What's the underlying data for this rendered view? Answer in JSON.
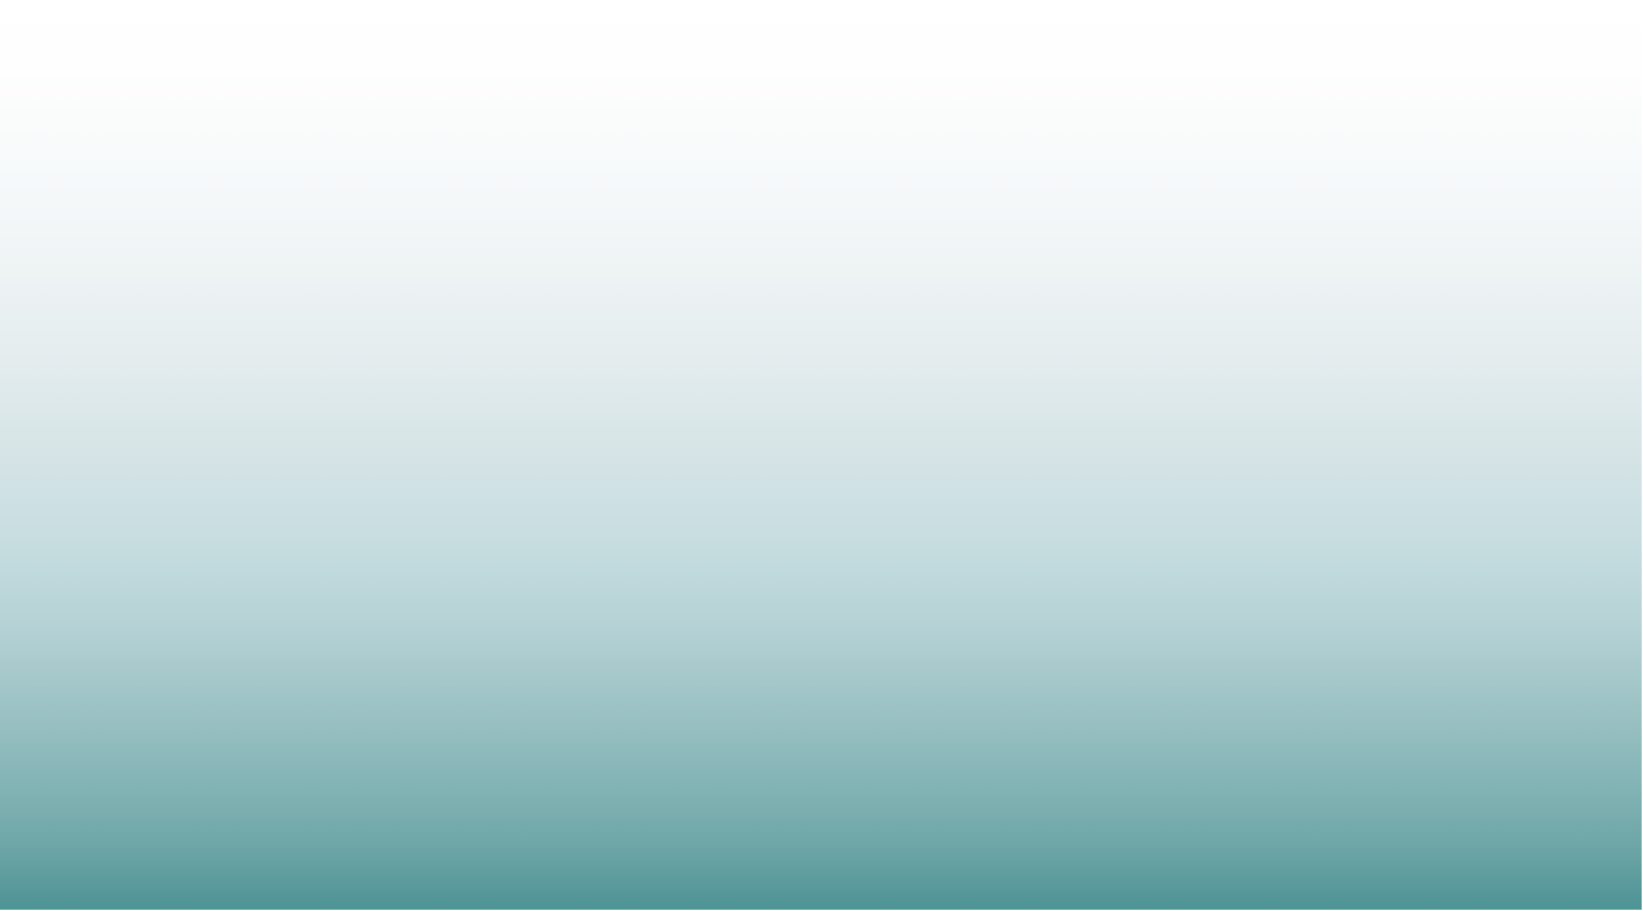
{
  "background": {
    "gradient_top": "#ffffff",
    "gradient_middle": "#d5e4e6",
    "gradient_bottom": "#4e9395"
  }
}
